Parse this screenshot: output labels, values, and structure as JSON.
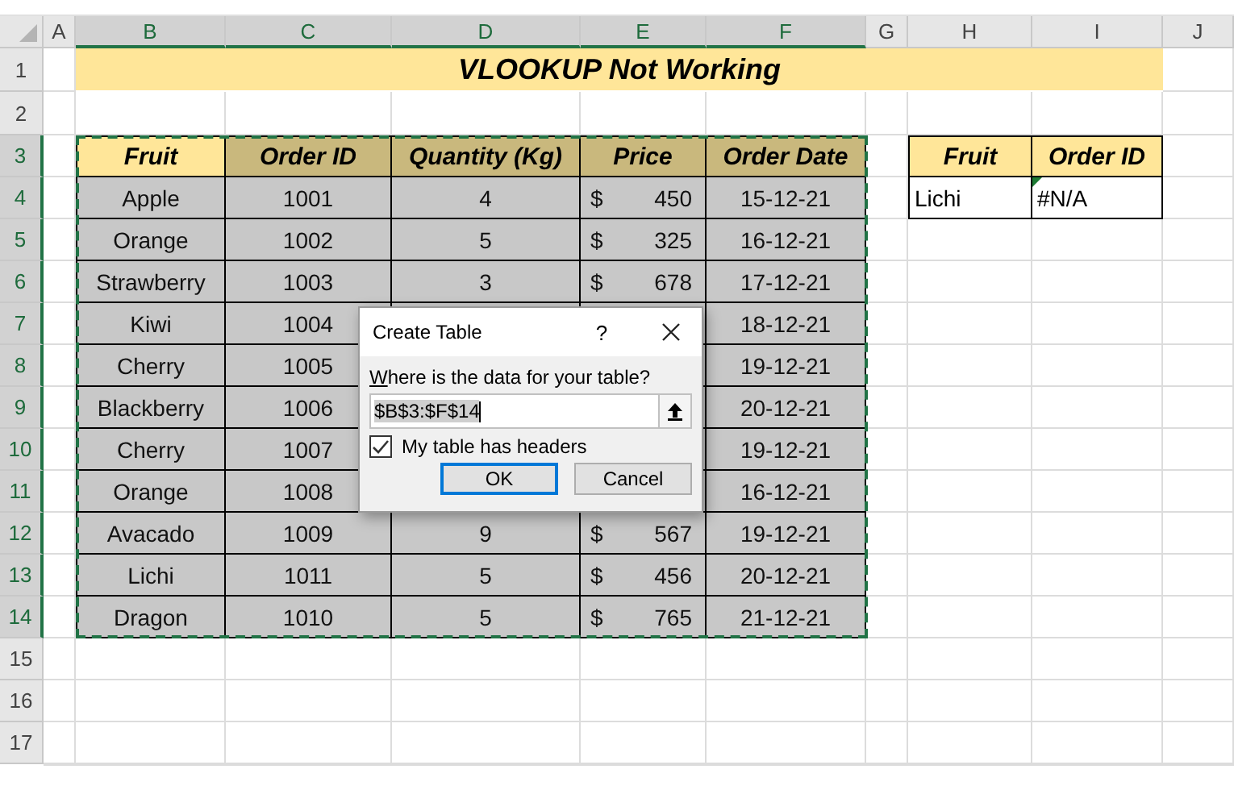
{
  "sheet": {
    "columns": [
      {
        "label": "A",
        "selected": false
      },
      {
        "label": "B",
        "selected": true
      },
      {
        "label": "C",
        "selected": true
      },
      {
        "label": "D",
        "selected": true
      },
      {
        "label": "E",
        "selected": true
      },
      {
        "label": "F",
        "selected": true
      },
      {
        "label": "G",
        "selected": false
      },
      {
        "label": "H",
        "selected": false
      },
      {
        "label": "I",
        "selected": false
      },
      {
        "label": "J",
        "selected": false
      }
    ],
    "row_numbers": [
      {
        "label": "1",
        "selected": false
      },
      {
        "label": "2",
        "selected": false
      },
      {
        "label": "3",
        "selected": true
      },
      {
        "label": "4",
        "selected": true
      },
      {
        "label": "5",
        "selected": true
      },
      {
        "label": "6",
        "selected": true
      },
      {
        "label": "7",
        "selected": true
      },
      {
        "label": "8",
        "selected": true
      },
      {
        "label": "9",
        "selected": true
      },
      {
        "label": "10",
        "selected": true
      },
      {
        "label": "11",
        "selected": true
      },
      {
        "label": "12",
        "selected": true
      },
      {
        "label": "13",
        "selected": true
      },
      {
        "label": "14",
        "selected": true
      },
      {
        "label": "15",
        "selected": false
      },
      {
        "label": "16",
        "selected": false
      },
      {
        "label": "17",
        "selected": false
      }
    ]
  },
  "title": "VLOOKUP Not Working",
  "data_table": {
    "selected": true,
    "headers": [
      {
        "text": "Fruit",
        "active": true
      },
      {
        "text": "Order ID",
        "active": false
      },
      {
        "text": "Quantity (Kg)",
        "active": false
      },
      {
        "text": "Price",
        "active": false
      },
      {
        "text": "Order Date",
        "active": false
      }
    ],
    "rows": [
      {
        "fruit": "Apple",
        "order_id": "1001",
        "quantity": "4",
        "currency": "$",
        "price": "450",
        "date": "15-12-21"
      },
      {
        "fruit": "Orange",
        "order_id": "1002",
        "quantity": "5",
        "currency": "$",
        "price": "325",
        "date": "16-12-21"
      },
      {
        "fruit": "Strawberry",
        "order_id": "1003",
        "quantity": "3",
        "currency": "$",
        "price": "678",
        "date": "17-12-21"
      },
      {
        "fruit": "Kiwi",
        "order_id": "1004",
        "quantity": null,
        "currency": null,
        "price": null,
        "date": "18-12-21"
      },
      {
        "fruit": "Cherry",
        "order_id": "1005",
        "quantity": null,
        "currency": null,
        "price": null,
        "date": "19-12-21"
      },
      {
        "fruit": "Blackberry",
        "order_id": "1006",
        "quantity": null,
        "currency": null,
        "price": null,
        "date": "20-12-21"
      },
      {
        "fruit": "Cherry",
        "order_id": "1007",
        "quantity": null,
        "currency": null,
        "price": null,
        "date": "19-12-21"
      },
      {
        "fruit": "Orange",
        "order_id": "1008",
        "quantity": null,
        "currency": null,
        "price": null,
        "date": "16-12-21"
      },
      {
        "fruit": "Avacado",
        "order_id": "1009",
        "quantity": "9",
        "currency": "$",
        "price": "567",
        "date": "19-12-21"
      },
      {
        "fruit": "Lichi",
        "order_id": "1011",
        "quantity": "5",
        "currency": "$",
        "price": "456",
        "date": "20-12-21"
      },
      {
        "fruit": "Dragon",
        "order_id": "1010",
        "quantity": "5",
        "currency": "$",
        "price": "765",
        "date": "21-12-21"
      }
    ]
  },
  "lookup_table": {
    "headers": [
      "Fruit",
      "Order ID"
    ],
    "row": {
      "fruit": "Lichi",
      "result": "#N/A",
      "error_flag": true
    }
  },
  "dialog": {
    "title": "Create Table",
    "help": "?",
    "prompt": "Where is the data for your table?",
    "range": "$B$3:$F$14",
    "headers_label": "My table has headers",
    "has_headers": true,
    "buttons": [
      {
        "label": "OK",
        "focused": true
      },
      {
        "label": "Cancel",
        "focused": false
      }
    ]
  }
}
